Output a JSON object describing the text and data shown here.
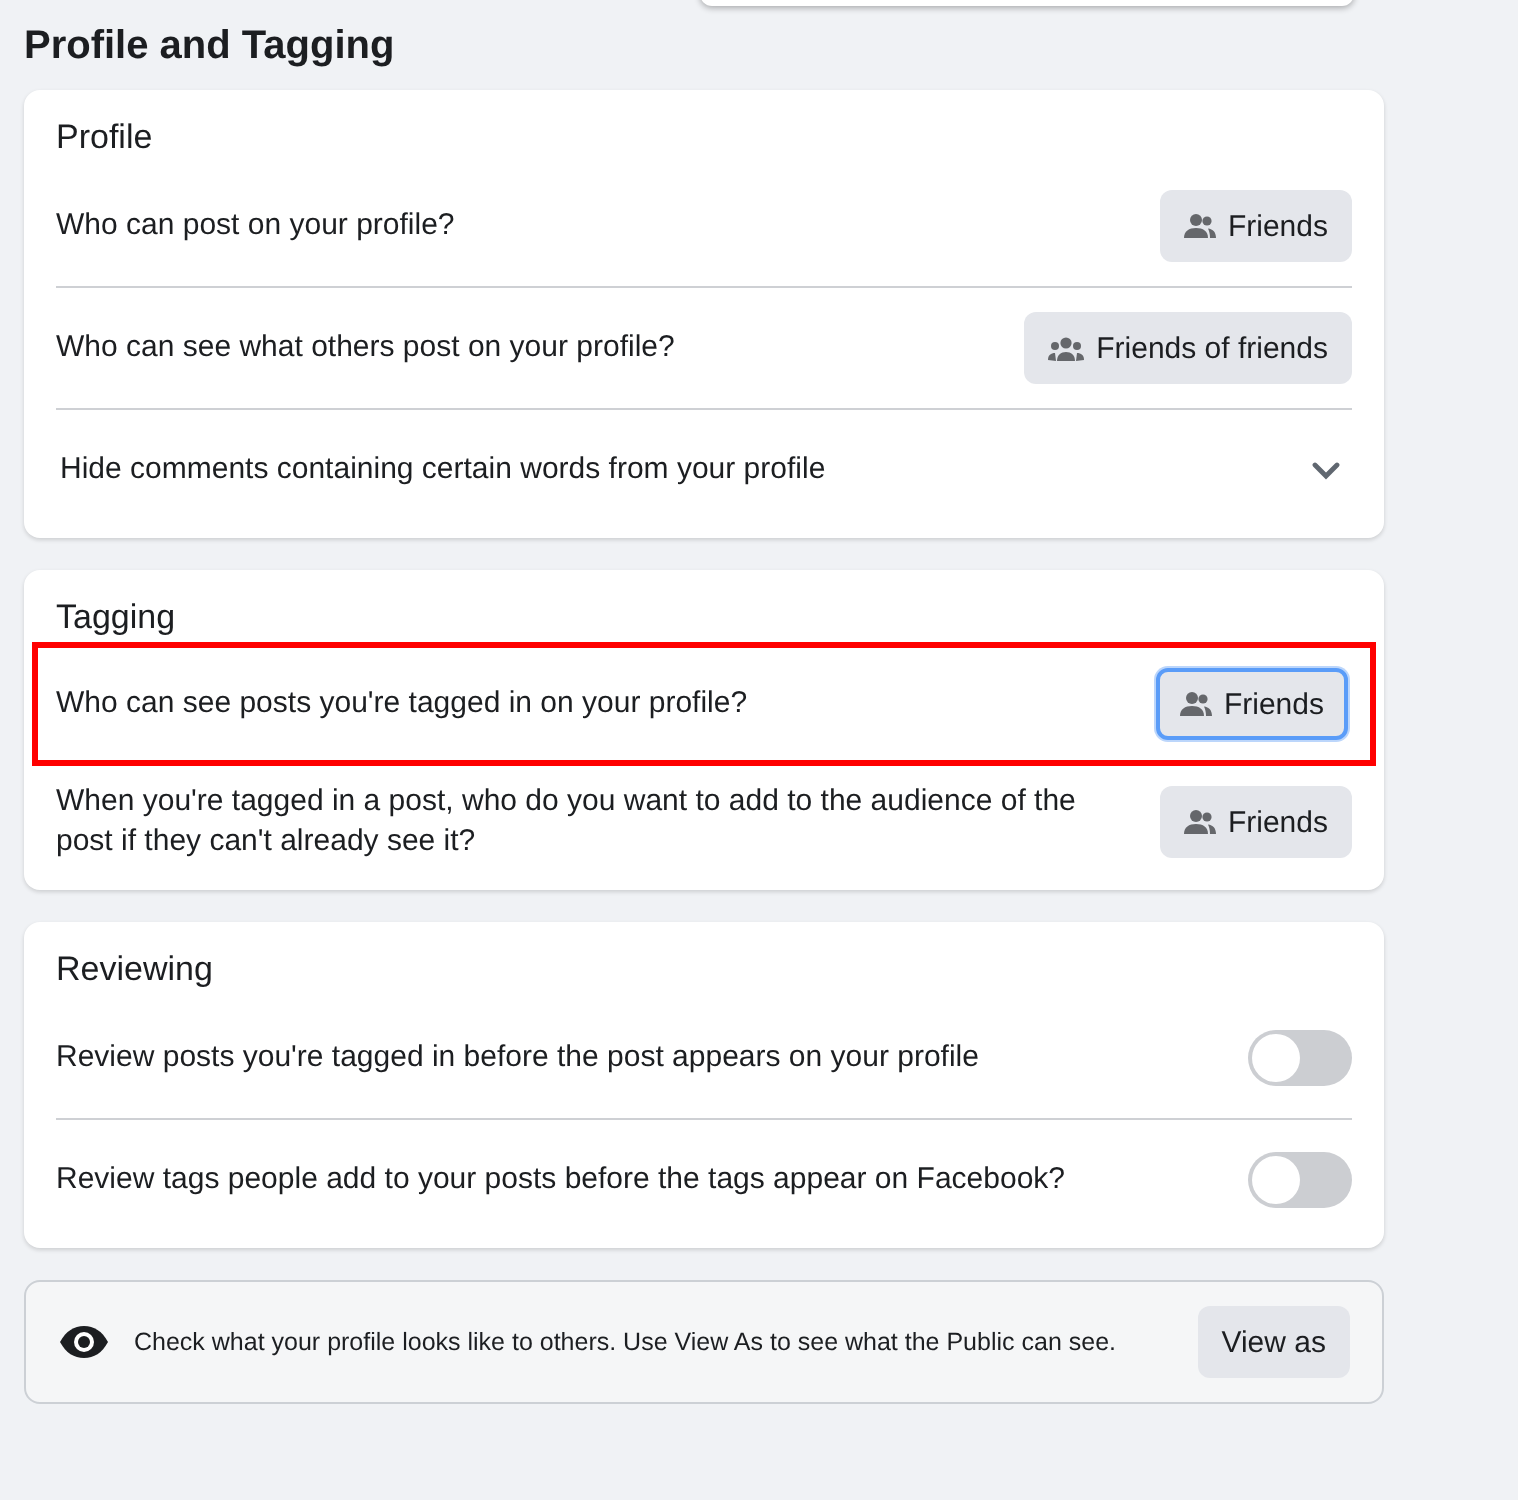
{
  "title": "Profile and Tagging",
  "sections": [
    {
      "heading": "Profile",
      "rows": [
        {
          "kind": "dropdown",
          "label": "Who can post on your profile?",
          "highlighted": false,
          "button": {
            "kind": "friends",
            "label": "Friends",
            "focused": false
          }
        },
        {
          "kind": "dropdown",
          "label": "Who can see what others post on your profile?",
          "highlighted": false,
          "button": {
            "kind": "friends_of_friends",
            "label": "Friends of friends",
            "focused": false
          }
        },
        {
          "kind": "expand",
          "label": "Hide comments containing certain words from your profile",
          "expanded": false
        }
      ]
    },
    {
      "heading": "Tagging",
      "rows": [
        {
          "kind": "dropdown",
          "label": "Who can see posts you're tagged in on your profile?",
          "highlighted": true,
          "button": {
            "kind": "friends",
            "label": "Friends",
            "focused": true
          }
        },
        {
          "kind": "dropdown",
          "label": "When you're tagged in a post, who do you want to add to the audience of the post if they can't already see it?",
          "highlighted": false,
          "button": {
            "kind": "friends",
            "label": "Friends",
            "focused": false
          }
        }
      ]
    },
    {
      "heading": "Reviewing",
      "rows": [
        {
          "kind": "toggle",
          "label": "Review posts you're tagged in before the post appears on your profile",
          "on": false
        },
        {
          "kind": "toggle",
          "label": "Review tags people add to your posts before the tags appear on Facebook?",
          "on": false
        }
      ]
    }
  ],
  "view_as": {
    "text": "Check what your profile looks like to others. Use View As to see what the Public can see.",
    "button": "View as"
  }
}
